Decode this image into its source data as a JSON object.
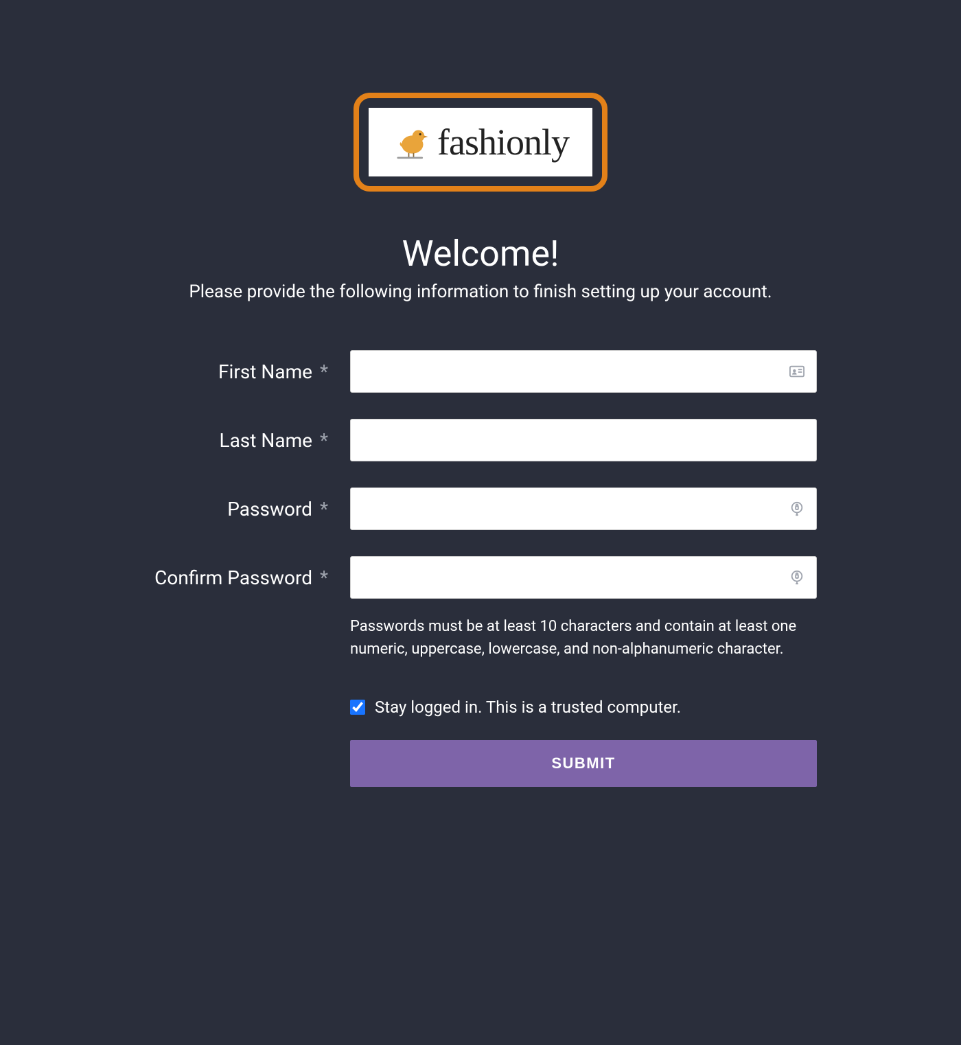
{
  "logo": {
    "brand_name": "fashionly"
  },
  "welcome": {
    "title": "Welcome!",
    "subtitle": "Please provide the following information to finish setting up your account."
  },
  "form": {
    "first_name": {
      "label": "First Name",
      "required_marker": "*",
      "value": ""
    },
    "last_name": {
      "label": "Last Name",
      "required_marker": "*",
      "value": ""
    },
    "password": {
      "label": "Password",
      "required_marker": "*",
      "value": ""
    },
    "confirm_password": {
      "label": "Confirm Password",
      "required_marker": "*",
      "value": ""
    },
    "password_help": "Passwords must be at least 10 characters and contain at least one numeric, uppercase, lowercase, and non-alphanumeric character.",
    "stay_logged_in": {
      "label": "Stay logged in. This is a trusted computer.",
      "checked": true
    },
    "submit_label": "SUBMIT"
  }
}
